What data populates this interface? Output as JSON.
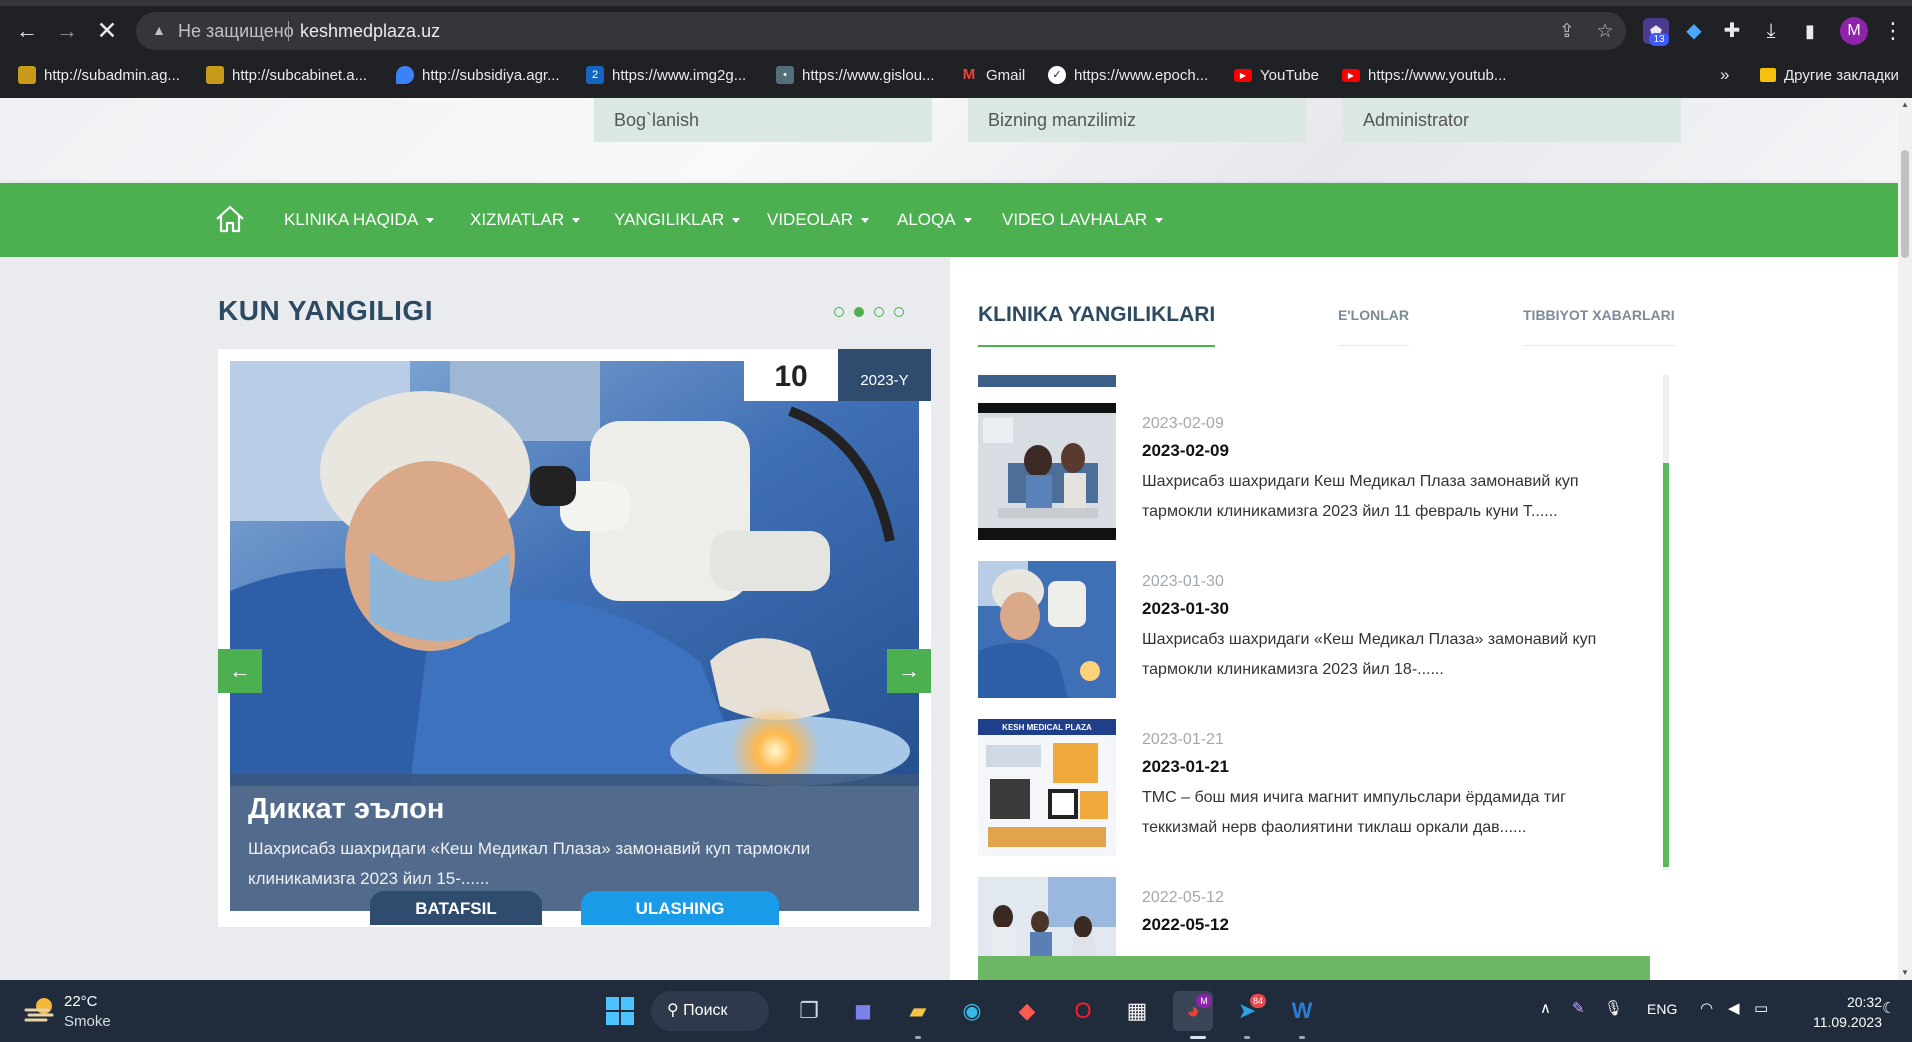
{
  "browser": {
    "security_text": "Не защищено",
    "url": "keshmedplaza.uz",
    "ext_counter_badge": "13",
    "profile_letter": "M",
    "bookmarks": [
      {
        "label": "http://subadmin.ag...",
        "color": "#c79a1a",
        "icon": "layers-icon"
      },
      {
        "label": "http://subcabinet.a...",
        "color": "#c79a1a",
        "icon": "layers-icon"
      },
      {
        "label": "http://subsidiya.agr...",
        "color": "#3b82f6",
        "icon": "drop-icon"
      },
      {
        "label": "https://www.img2g...",
        "color": "#1565c0",
        "icon": "img2go-icon"
      },
      {
        "label": "https://www.gislou...",
        "color": "#546e7a",
        "icon": "gislounge-icon"
      },
      {
        "label": "Gmail",
        "color": "#ea4335",
        "icon": "gmail-icon"
      },
      {
        "label": "https://www.epoch...",
        "color": "#ffffff",
        "icon": "epoch-icon"
      },
      {
        "label": "YouTube",
        "color": "#ff0000",
        "icon": "youtube-icon"
      },
      {
        "label": "https://www.youtub...",
        "color": "#ff0000",
        "icon": "youtube-icon"
      }
    ],
    "other_bookmarks": "Другие закладки"
  },
  "site": {
    "top_links": [
      "Bog`lanish",
      "Bizning manzilimiz",
      "Administrator"
    ],
    "nav": [
      "KLINIKA HAQIDA",
      "XIZMATLAR",
      "YANGILIKLAR",
      "VIDEOLAR",
      "ALOQA",
      "VIDEO LAVHALAR"
    ],
    "accent_color": "#4caf50",
    "kun_yangiligi": {
      "title": "KUN YANGILIGI",
      "dots_total": 4,
      "dots_active_index": 1,
      "day": "10",
      "year": "2023-Y",
      "caption_title": "Диккат эълон",
      "caption_text": "Шахрисабз шахридаги «Кеш Медикал Плаза» замонавий куп тармокли клиникамизга 2023 йил 15-......",
      "prev_arrow": "←",
      "next_arrow": "→",
      "btn_more": "BATAFSIL",
      "btn_share": "ULASHING"
    },
    "news_tabs": [
      "KLINIKA YANGILIKLARI",
      "E'LONLAR",
      "TIBBIYOT XABARLARI"
    ],
    "news": [
      {
        "date_grey": "2023-02-09",
        "date_bold": "2023-02-09",
        "text": "Шахрисабз шахридаги Кеш Медикал Плаза замонавий куп тармокли клиникамизга 2023 йил 11 февраль куни Т......"
      },
      {
        "date_grey": "2023-01-30",
        "date_bold": "2023-01-30",
        "text": "Шахрисабз шахридаги «Кеш Медикал Плаза» замонавий куп тармокли клиникамизга 2023 йил 18-......"
      },
      {
        "date_grey": "2023-01-21",
        "date_bold": "2023-01-21",
        "text": "ТМС – бош мия ичига магнит импульслари ёрдамида тиг теккизмай нерв фаолиятини тиклаш оркали дав......"
      },
      {
        "date_grey": "2022-05-12",
        "date_bold": "2022-05-12",
        "text": ""
      }
    ],
    "news_thumb_label": "KESH MEDICAL PLAZA"
  },
  "taskbar": {
    "temperature": "22°C",
    "weather": "Smoke",
    "search_label": "Поиск",
    "telegram_badge": "84",
    "teams_badge": "M",
    "language": "ENG",
    "time": "20:32",
    "date": "11.09.2023"
  }
}
